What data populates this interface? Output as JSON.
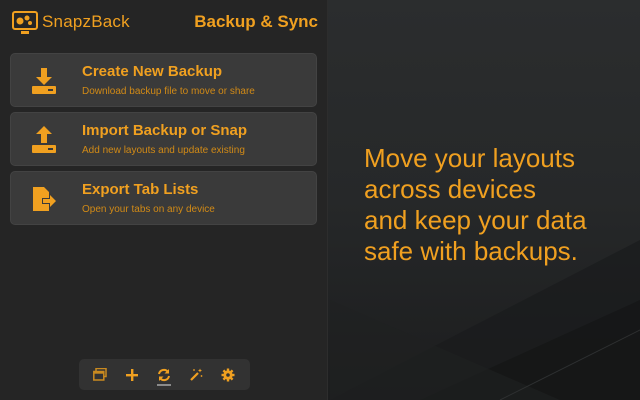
{
  "header": {
    "app_name": "SnapzBack",
    "page_title": "Backup & Sync"
  },
  "actions": [
    {
      "title": "Create New Backup",
      "subtitle": "Download backup file to move or share",
      "icon": "download-icon"
    },
    {
      "title": "Import Backup or Snap",
      "subtitle": "Add new layouts and update existing",
      "icon": "upload-icon"
    },
    {
      "title": "Export Tab Lists",
      "subtitle": "Open your tabs on any device",
      "icon": "export-icon"
    }
  ],
  "toolbar": {
    "items": [
      "layouts-icon",
      "add-icon",
      "sync-icon",
      "magic-wand-icon",
      "gear-icon"
    ],
    "active": "sync-icon"
  },
  "promo": {
    "lines": [
      "Move your layouts",
      "across devices",
      "and keep your data",
      "safe with backups."
    ]
  },
  "colors": {
    "accent": "#f0a020",
    "panel": "#252525",
    "card": "#3a3a3a"
  }
}
